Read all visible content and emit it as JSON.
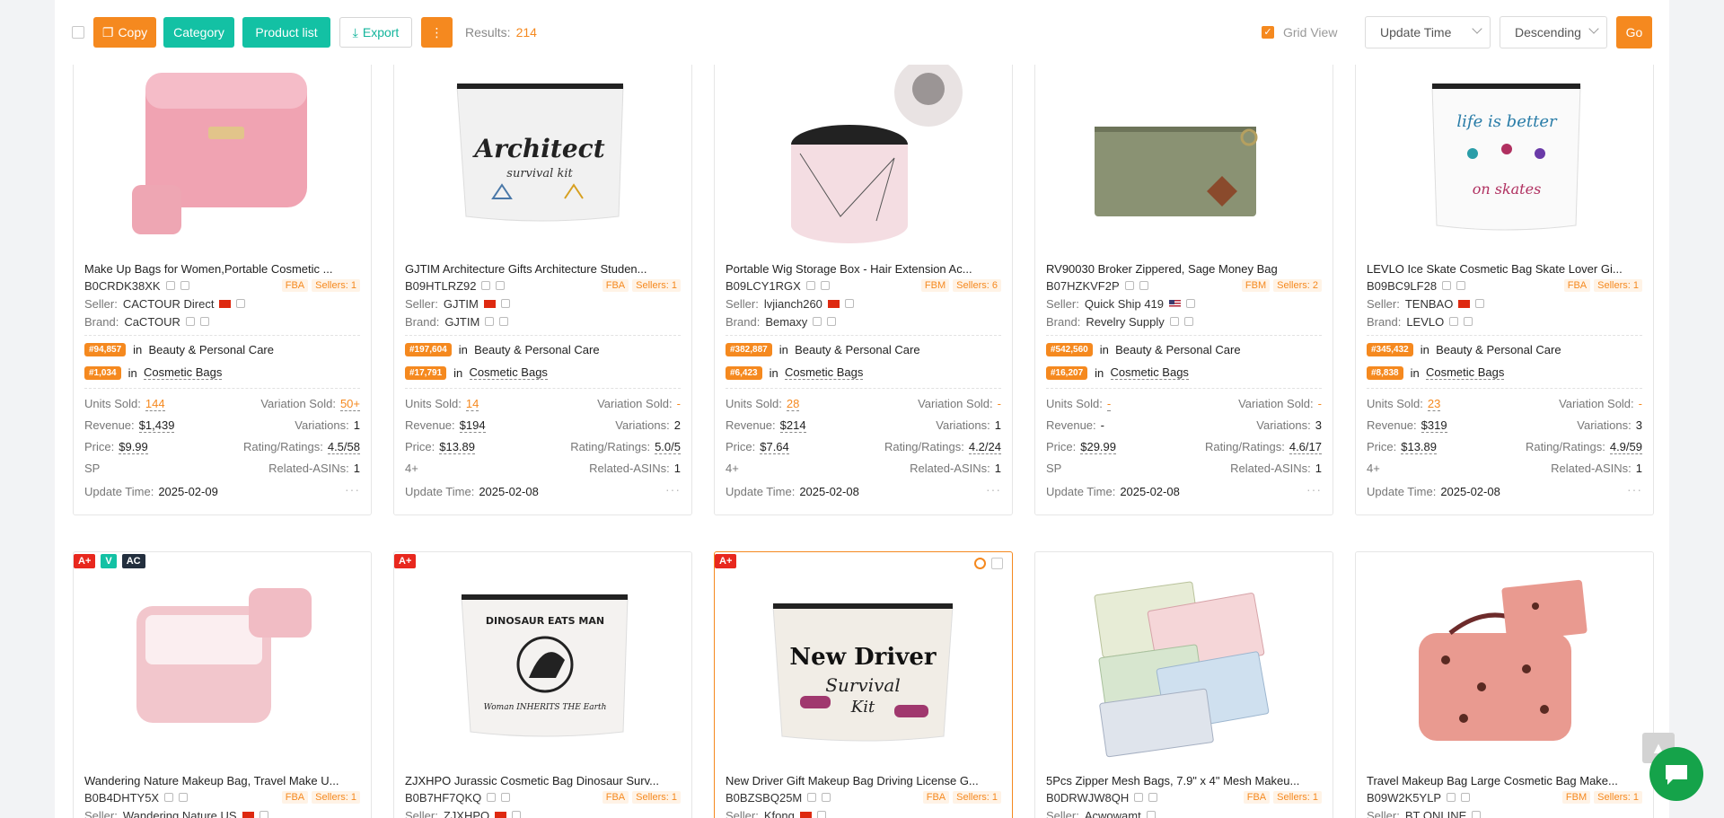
{
  "toolbar": {
    "copy": "Copy",
    "category": "Category",
    "product_list": "Product list",
    "export": "Export",
    "more": "⋮",
    "results_label": "Results:",
    "results_count": "214",
    "grid_view": "Grid View",
    "sort_field": "Update Time",
    "sort_order": "Descending",
    "go": "Go"
  },
  "labels": {
    "seller": "Seller:",
    "brand": "Brand:",
    "in": "in",
    "units_sold": "Units Sold:",
    "variation_sold": "Variation Sold:",
    "revenue": "Revenue:",
    "variations": "Variations:",
    "price": "Price:",
    "rating": "Rating/Ratings:",
    "related": "Related-ASINs:",
    "update_time": "Update Time:",
    "dots": "···"
  },
  "products": [
    {
      "title": "Make Up Bags for Women,Portable Cosmetic ...",
      "asin": "B0CRDK38XK",
      "fulfillment": "FBA",
      "sellers": "Sellers: 1",
      "seller": "CACTOUR Direct",
      "brand": "CaCTOUR",
      "rank1": "#94,857",
      "cat1": "Beauty & Personal Care",
      "rank2": "#1,034",
      "cat2": "Cosmetic Bags",
      "units": "144",
      "var_sold": "50+",
      "revenue": "$1,439",
      "variations": "1",
      "price": "$9.99",
      "rating": "4.5/58",
      "tagline": "SP",
      "related": "1",
      "update": "2025-02-09"
    },
    {
      "title": "GJTIM Architecture Gifts Architecture Studen...",
      "asin": "B09HTLRZ92",
      "fulfillment": "FBA",
      "sellers": "Sellers: 1",
      "seller": "GJTIM",
      "brand": "GJTIM",
      "rank1": "#197,604",
      "cat1": "Beauty & Personal Care",
      "rank2": "#17,791",
      "cat2": "Cosmetic Bags",
      "units": "14",
      "var_sold": "-",
      "revenue": "$194",
      "variations": "2",
      "price": "$13.89",
      "rating": "5.0/5",
      "tagline": "4+",
      "related": "1",
      "update": "2025-02-08"
    },
    {
      "title": "Portable Wig Storage Box - Hair Extension Ac...",
      "asin": "B09LCY1RGX",
      "fulfillment": "FBM",
      "sellers": "Sellers: 6",
      "seller": "lvjianch260",
      "brand": "Bemaxy",
      "rank1": "#382,887",
      "cat1": "Beauty & Personal Care",
      "rank2": "#6,423",
      "cat2": "Cosmetic Bags",
      "units": "28",
      "var_sold": "-",
      "revenue": "$214",
      "variations": "1",
      "price": "$7.64",
      "rating": "4.2/24",
      "tagline": "4+",
      "related": "1",
      "update": "2025-02-08"
    },
    {
      "title": "RV90030 Broker Zippered, Sage Money Bag",
      "asin": "B07HZKVF2P",
      "fulfillment": "FBM",
      "sellers": "Sellers: 2",
      "seller": "Quick Ship 419",
      "brand": "Revelry Supply",
      "rank1": "#542,560",
      "cat1": "Beauty & Personal Care",
      "rank2": "#16,207",
      "cat2": "Cosmetic Bags",
      "units": "-",
      "var_sold": "-",
      "revenue": "-",
      "variations": "3",
      "price": "$29.99",
      "rating": "4.6/17",
      "tagline": "SP",
      "related": "1",
      "update": "2025-02-08"
    },
    {
      "title": "LEVLO Ice Skate Cosmetic Bag Skate Lover Gi...",
      "asin": "B09BC9LF28",
      "fulfillment": "FBA",
      "sellers": "Sellers: 1",
      "seller": "TENBAO",
      "brand": "LEVLO",
      "rank1": "#345,432",
      "cat1": "Beauty & Personal Care",
      "rank2": "#8,838",
      "cat2": "Cosmetic Bags",
      "units": "23",
      "var_sold": "-",
      "revenue": "$319",
      "variations": "3",
      "price": "$13.89",
      "rating": "4.9/59",
      "tagline": "4+",
      "related": "1",
      "update": "2025-02-08"
    },
    {
      "title": "Wandering Nature Makeup Bag, Travel Make U...",
      "asin": "B0B4DHTY5X",
      "fulfillment": "FBA",
      "sellers": "Sellers: 1",
      "seller": "Wandering Nature US",
      "badges": [
        "A+",
        "V",
        "AC"
      ]
    },
    {
      "title": "ZJXHPO Jurassic Cosmetic Bag Dinosaur Surv...",
      "asin": "B0B7HF7QKQ",
      "fulfillment": "FBA",
      "sellers": "Sellers: 1",
      "seller": "ZJXHPO",
      "badges": [
        "A+"
      ]
    },
    {
      "title": "New Driver Gift Makeup Bag Driving License G...",
      "asin": "B0BZSBQ25M",
      "fulfillment": "FBA",
      "sellers": "Sellers: 1",
      "seller": "Kfong",
      "badges": [
        "A+"
      ]
    },
    {
      "title": "5Pcs Zipper Mesh Bags, 7.9\" x 4\" Mesh Makeu...",
      "asin": "B0DRWJW8QH",
      "fulfillment": "FBA",
      "sellers": "Sellers: 1",
      "seller": "Acwowamt",
      "badges": []
    },
    {
      "title": "Travel Makeup Bag Large Cosmetic Bag Make...",
      "asin": "B09W2K5YLP",
      "fulfillment": "FBM",
      "sellers": "Sellers: 1",
      "seller": "BT ONLINE",
      "badges": []
    }
  ],
  "image_text": {
    "architect": "Architect",
    "survival_kit": "survival kit",
    "life_better": "life is better",
    "on_skates": "on skates",
    "dino": "DINOSAUR EATS MAN",
    "woman": "Woman INHERITS THE Earth",
    "new_driver": "New Driver",
    "survival": "Survival",
    "kit": "Kit"
  },
  "colors": {
    "accent": "#f5891f",
    "teal": "#13c1a4",
    "badge_red": "#e8281e",
    "chat": "#15a34a"
  }
}
